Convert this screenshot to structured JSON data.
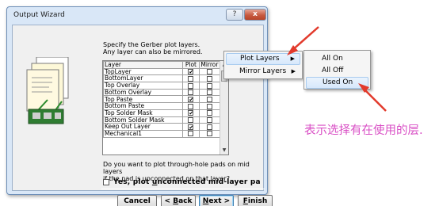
{
  "window": {
    "title": "Output Wizard",
    "help_glyph": "?",
    "close_glyph": "x"
  },
  "instruction": {
    "line1": "Specify the Gerber plot layers.",
    "line2": "Any layer can also be mirrored."
  },
  "layer_table": {
    "headers": [
      "Layer",
      "Plot",
      "Mirror"
    ],
    "rows": [
      {
        "layer": "TopLayer",
        "plot": true,
        "mirror": false
      },
      {
        "layer": "BottomLayer",
        "plot": false,
        "mirror": false
      },
      {
        "layer": "Top Overlay",
        "plot": false,
        "mirror": false
      },
      {
        "layer": "Bottom Overlay",
        "plot": false,
        "mirror": false
      },
      {
        "layer": "Top Paste",
        "plot": true,
        "mirror": false
      },
      {
        "layer": "Bottom Paste",
        "plot": false,
        "mirror": false
      },
      {
        "layer": "Top Solder Mask",
        "plot": true,
        "mirror": false
      },
      {
        "layer": "Bottom Solder Mask",
        "plot": false,
        "mirror": false
      },
      {
        "layer": "Keep Out Layer",
        "plot": true,
        "mirror": false
      },
      {
        "layer": "Mechanical1",
        "plot": false,
        "mirror": false
      }
    ]
  },
  "question": {
    "line1": "Do you want to plot through-hole pads on mid layers",
    "line2": "if the pad is unconnected on that layer?"
  },
  "option": {
    "label_prefix": "Yes, plot ",
    "label_accel": "u",
    "label_suffix": "nconnected mid-layer pa",
    "checked": false
  },
  "buttons": {
    "cancel": "Cancel",
    "back_prefix": "< ",
    "back_accel": "B",
    "back_suffix": "ack",
    "next_accel": "N",
    "next_suffix": "ext >",
    "finish_accel": "F",
    "finish_suffix": "inish"
  },
  "context_menu": {
    "items": [
      {
        "label": "Plot Layers",
        "submenu": true,
        "highlighted": true
      },
      {
        "label": "Mirror Layers",
        "submenu": true,
        "highlighted": false
      }
    ]
  },
  "submenu": {
    "items": [
      {
        "label": "All On",
        "highlighted": false
      },
      {
        "label": "All Off",
        "highlighted": false
      },
      {
        "label": "Used On",
        "highlighted": true
      }
    ]
  },
  "annotation": {
    "text": "表示选择有在使用的层."
  },
  "colors": {
    "annotation_text": "#d94fc5",
    "annotation_arrow": "#e23a2c",
    "menu_highlight": "#d7e8fb",
    "dialog_frame": "#d9e7f7"
  }
}
